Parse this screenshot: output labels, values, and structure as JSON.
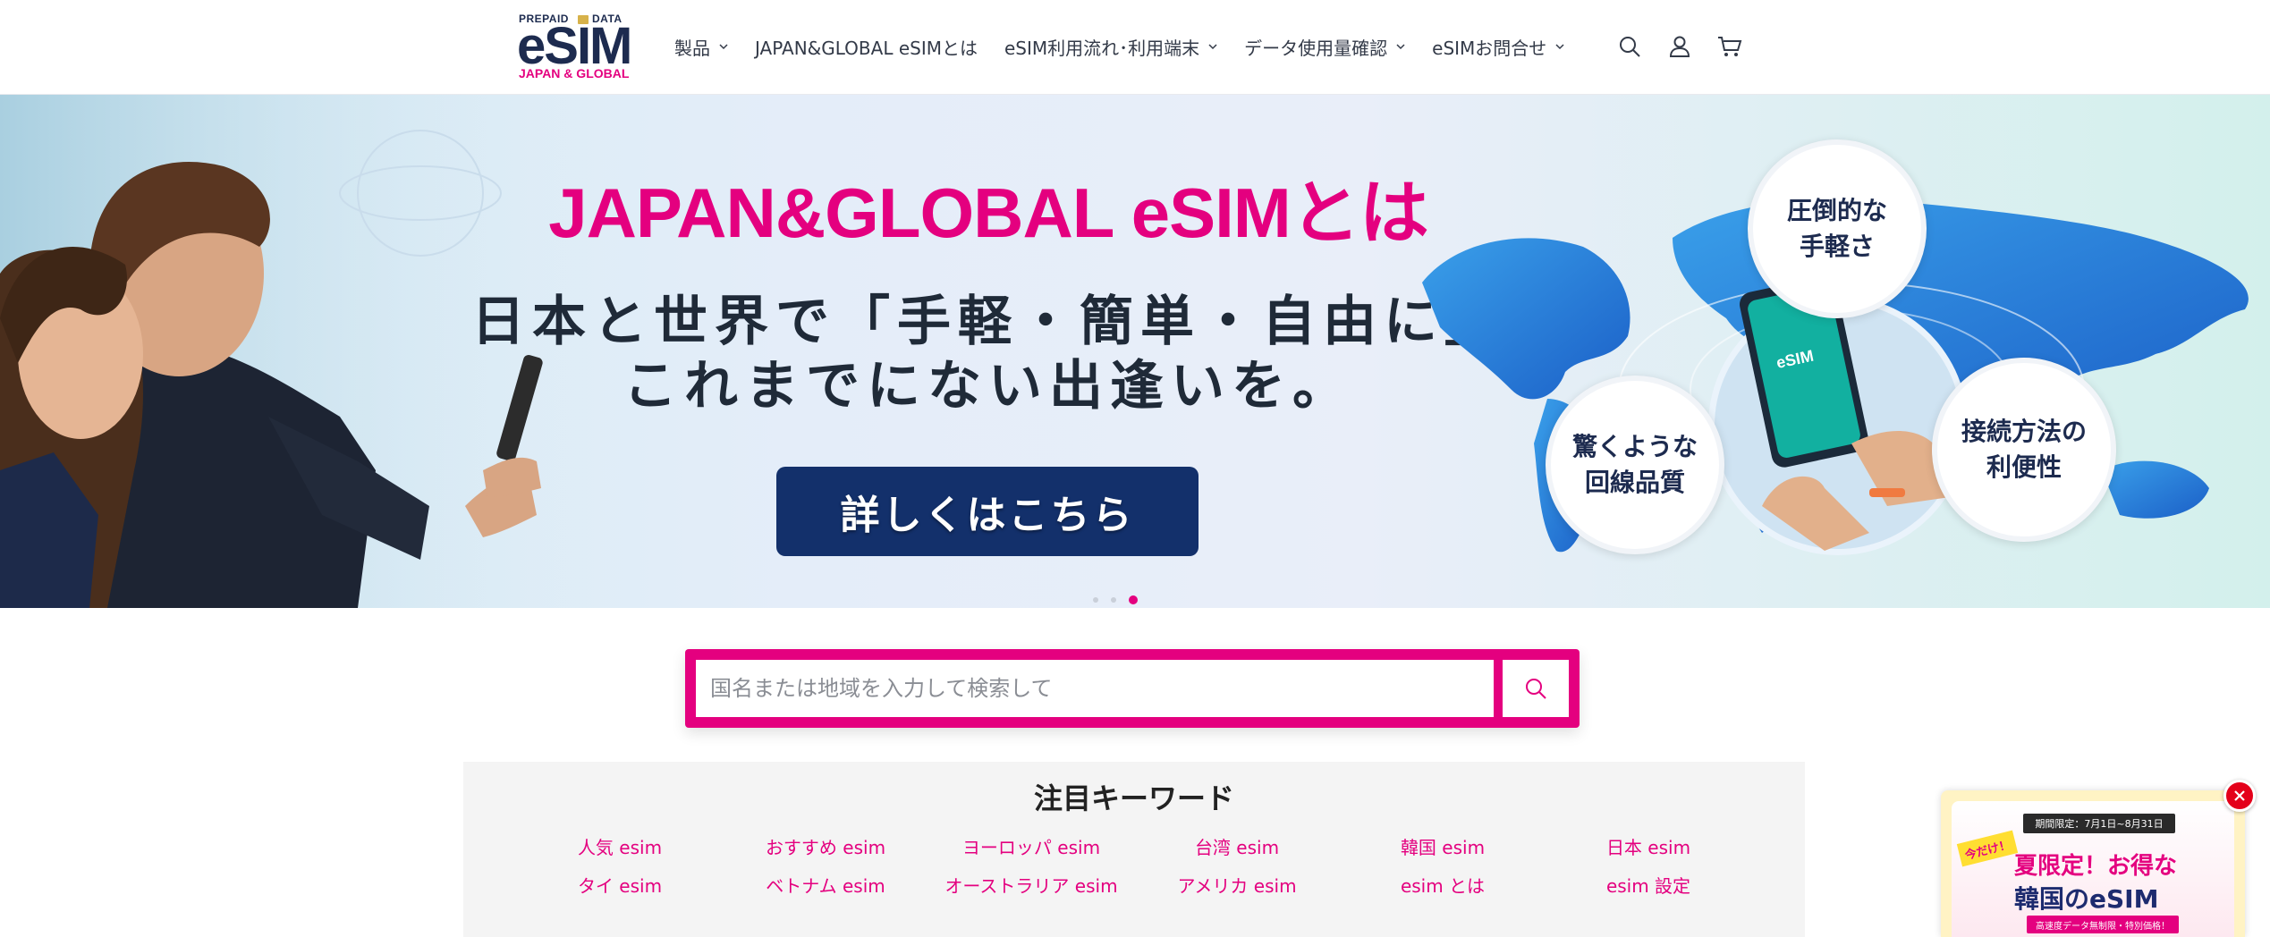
{
  "brand": {
    "logo_small": "PREPAID",
    "logo_small2": "DATA",
    "logo_main": "eSIM",
    "logo_sub": "JAPAN & GLOBAL",
    "accent_color": "#e4007f",
    "navy_color": "#13306b"
  },
  "nav": [
    {
      "label": "製品",
      "has_dropdown": true
    },
    {
      "label": "JAPAN&GLOBAL eSIMとは",
      "has_dropdown": false
    },
    {
      "label": "eSIM利用流れ･利用端末",
      "has_dropdown": true
    },
    {
      "label": "データ使用量確認",
      "has_dropdown": true
    },
    {
      "label": "eSIMお問合せ",
      "has_dropdown": true
    }
  ],
  "header_icons": [
    "search-icon",
    "account-icon",
    "cart-icon"
  ],
  "hero": {
    "title": "JAPAN&GLOBAL eSIMとは",
    "subtitle_line1": "日本と世界で「手軽・簡単・自由に」",
    "subtitle_line2": "これまでにない出逢いを。",
    "button_label": "詳しくはこちら",
    "phone_label": "eSIM",
    "bubbles": [
      {
        "line1": "圧倒的な",
        "line2": "手軽さ"
      },
      {
        "line1": "驚くような",
        "line2": "回線品質"
      },
      {
        "line1": "接続方法の",
        "line2": "利便性"
      }
    ],
    "slide_count": 3,
    "active_slide": 3
  },
  "search": {
    "placeholder": "国名または地域を入力して検索して",
    "value": ""
  },
  "keywords": {
    "title": "注目キーワード",
    "items": [
      "人気 esim",
      "おすすめ esim",
      "ヨーロッパ esim",
      "台湾 esim",
      "韓国 esim",
      "日本 esim",
      "タイ esim",
      "ベトナム esim",
      "オーストラリア esim",
      "アメリカ esim",
      "esim とは",
      "esim 設定"
    ]
  },
  "promo": {
    "ribbon": "期間限定：7月1日~8月31日",
    "tag": "今だけ！",
    "line1": "夏限定！お得な",
    "line2": "韓国のeSIM",
    "line3": "高速度データ無制限・特別価格！"
  }
}
